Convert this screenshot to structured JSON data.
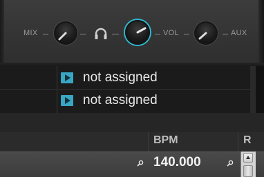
{
  "mixer": {
    "mix_label": "MIX",
    "vol_label": "VOL",
    "aux_label": "AUX",
    "headphones_icon": "headphones-icon",
    "accent": "#2fb7cf"
  },
  "assignments": [
    {
      "label": "not assigned",
      "icon": "play-icon"
    },
    {
      "label": "not assigned",
      "icon": "play-icon"
    }
  ],
  "browser": {
    "columns": {
      "bpm": "BPM",
      "r": "R"
    },
    "row": {
      "bpm": "140.000"
    },
    "search_icon": "search-icon"
  }
}
